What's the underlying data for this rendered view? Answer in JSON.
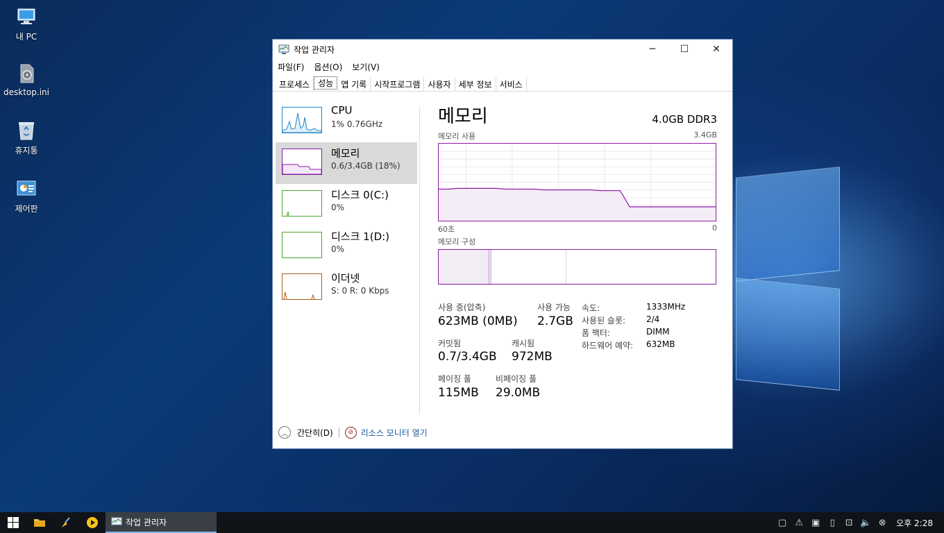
{
  "desktop": {
    "icons": [
      {
        "label": "내 PC",
        "icon": "computer-icon"
      },
      {
        "label": "desktop.ini",
        "icon": "settings-file-icon"
      },
      {
        "label": "휴지통",
        "icon": "recycle-bin-icon"
      },
      {
        "label": "제어판",
        "icon": "control-panel-icon"
      }
    ]
  },
  "window": {
    "title": "작업 관리자",
    "icon": "task-manager-icon",
    "controls": {
      "minimize": "─",
      "maximize": "☐",
      "close": "✕"
    },
    "menu": [
      "파일(F)",
      "옵션(O)",
      "보기(V)"
    ],
    "tabs": [
      {
        "label": "프로세스",
        "active": false
      },
      {
        "label": "성능",
        "active": true
      },
      {
        "label": "앱 기록",
        "active": false
      },
      {
        "label": "시작프로그램",
        "active": false
      },
      {
        "label": "사용자",
        "active": false
      },
      {
        "label": "세부 정보",
        "active": false
      },
      {
        "label": "서비스",
        "active": false
      }
    ]
  },
  "sidebar": {
    "items": [
      {
        "name": "CPU",
        "detail": "1% 0.76GHz",
        "color": "#1f86c9",
        "selected": false
      },
      {
        "name": "메모리",
        "detail": "0.6/3.4GB (18%)",
        "color": "#8b1aa3",
        "selected": true
      },
      {
        "name": "디스크 0(C:)",
        "detail": "0%",
        "color": "#4ea72e",
        "selected": false
      },
      {
        "name": "디스크 1(D:)",
        "detail": "0%",
        "color": "#4ea72e",
        "selected": false
      },
      {
        "name": "이더넷",
        "detail": "S: 0 R: 0 Kbps",
        "color": "#a75d1a",
        "selected": false
      }
    ]
  },
  "memory": {
    "title": "메모리",
    "spec": "4.0GB DDR3",
    "usage_label": "메모리 사용",
    "usage_max": "3.4GB",
    "x_left": "60초",
    "x_right": "0",
    "composition_label": "메모리 구성",
    "usage_history_fraction": [
      0.41,
      0.41,
      0.42,
      0.42,
      0.42,
      0.42,
      0.42,
      0.41,
      0.41,
      0.41,
      0.41,
      0.4,
      0.4,
      0.4,
      0.4,
      0.4,
      0.4,
      0.39,
      0.39,
      0.39,
      0.18,
      0.18,
      0.18,
      0.18,
      0.18,
      0.18,
      0.18,
      0.18,
      0.18,
      0.18
    ],
    "composition": {
      "in_use": 0.18,
      "modified": 0.01,
      "standby": 0.27,
      "free": 0.54
    },
    "stats": {
      "in_use_label": "사용 중(압축)",
      "in_use_value": "623MB (0MB)",
      "available_label": "사용 가능",
      "available_value": "2.7GB",
      "committed_label": "커밋됨",
      "committed_value": "0.7/3.4GB",
      "cached_label": "캐시됨",
      "cached_value": "972MB",
      "paged_label": "페이징 풀",
      "paged_value": "115MB",
      "nonpaged_label": "비페이징 풀",
      "nonpaged_value": "29.0MB"
    },
    "props": [
      {
        "key": "속도:",
        "value": "1333MHz"
      },
      {
        "key": "사용된 슬롯:",
        "value": "2/4"
      },
      {
        "key": "폼 팩터:",
        "value": "DIMM"
      },
      {
        "key": "하드웨어 예약:",
        "value": "632MB"
      }
    ]
  },
  "footer": {
    "fewer_details": "간단히(D)",
    "resource_monitor": "리소스 모니터 열기"
  },
  "taskbar": {
    "active_app": "작업 관리자",
    "clock": "오후 2:28"
  }
}
